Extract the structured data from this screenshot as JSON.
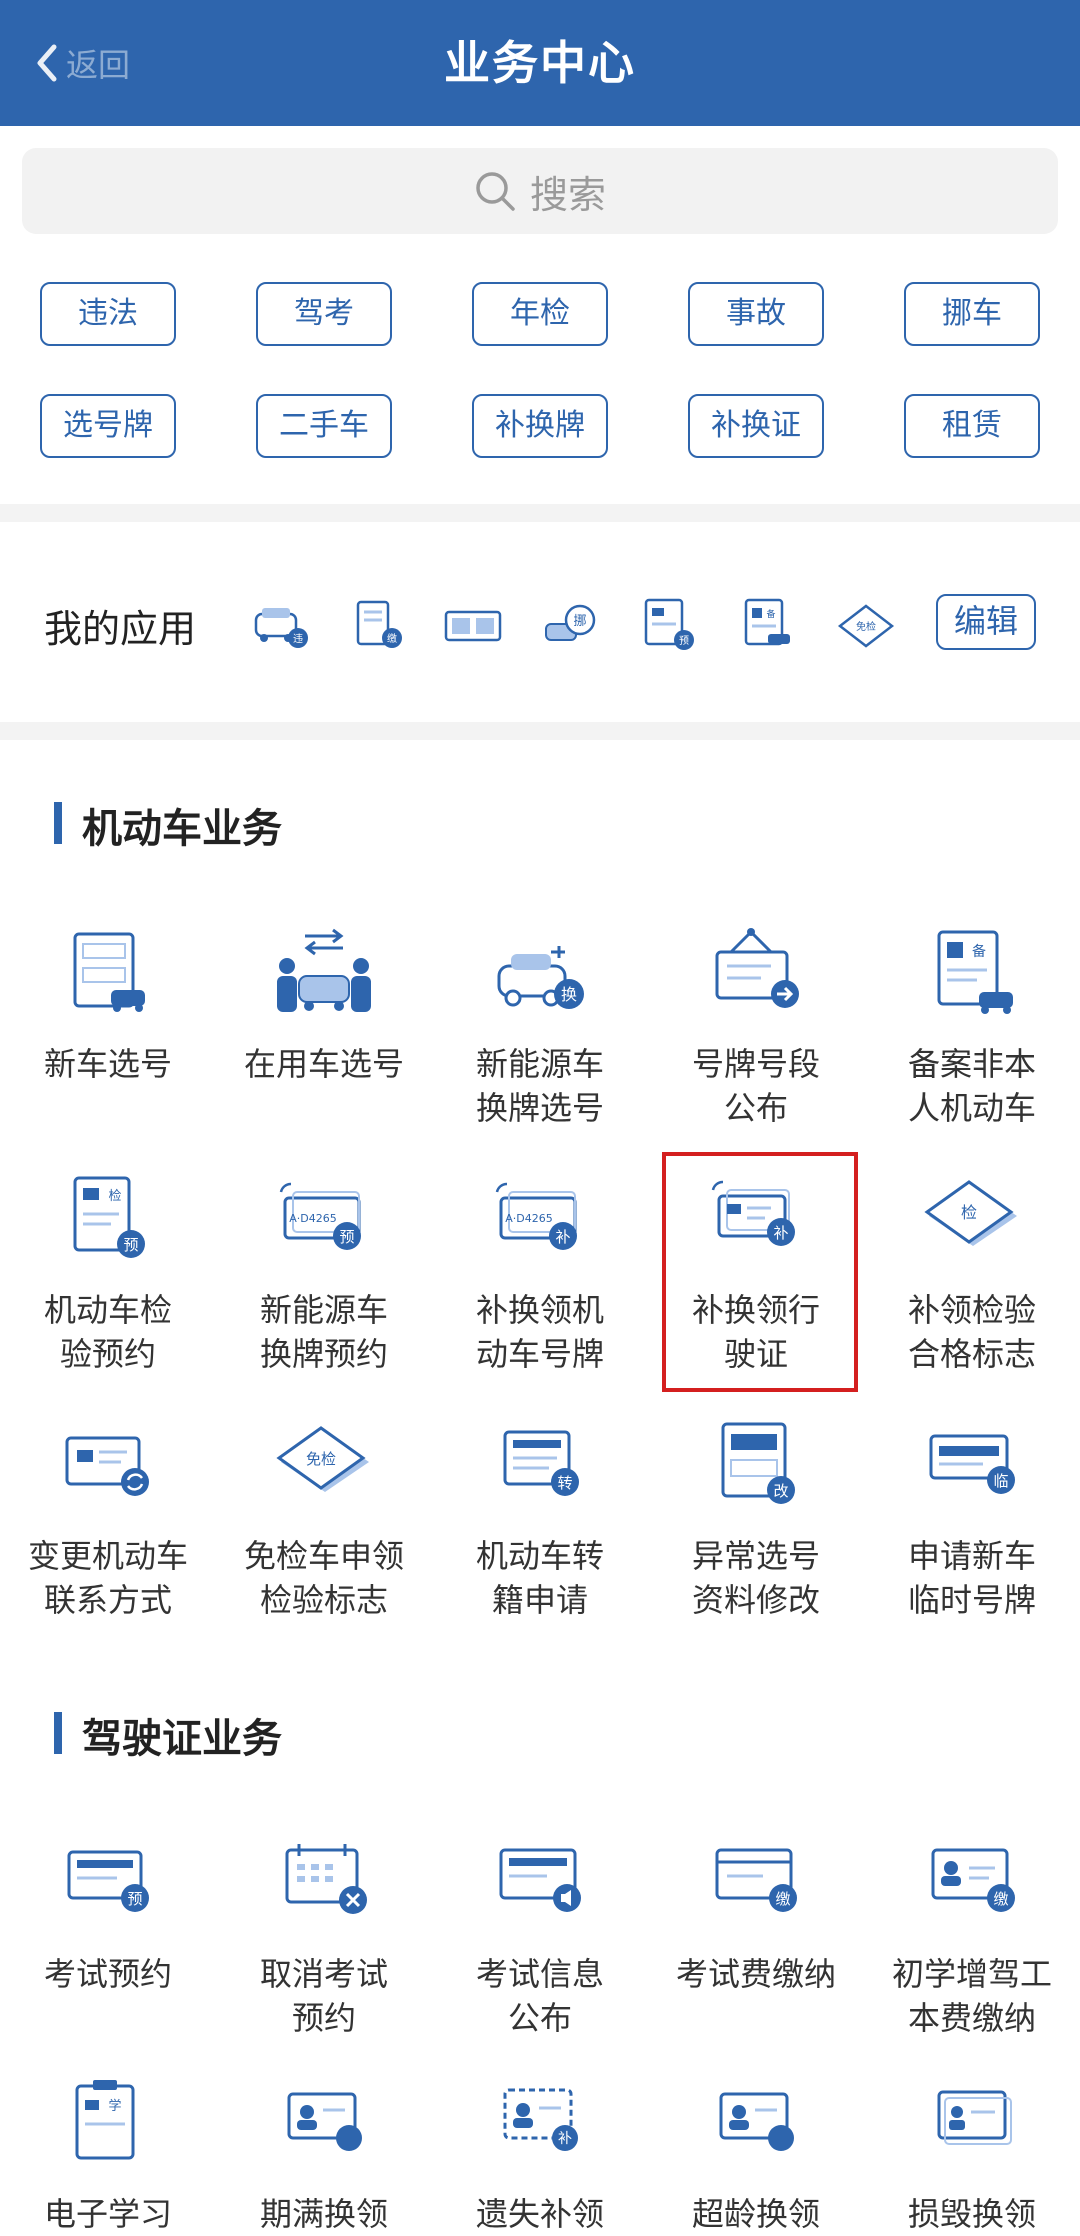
{
  "header": {
    "title": "业务中心",
    "back_label": "返回"
  },
  "search": {
    "placeholder": "搜索"
  },
  "quick_tags": [
    "违法",
    "驾考",
    "年检",
    "事故",
    "挪车",
    "选号牌",
    "二手车",
    "补换牌",
    "补换证",
    "租赁"
  ],
  "my_apps": {
    "label": "我的应用",
    "edit_label": "编辑",
    "icons": [
      "car-violation-icon",
      "document-pay-icon",
      "plates-icon",
      "move-car-icon",
      "inspection-booking-icon",
      "record-icon",
      "inspection-exempt-icon"
    ],
    "badges": [
      "违",
      "缴",
      "",
      "挪",
      "预",
      "备",
      "免检"
    ]
  },
  "motor_section": {
    "title": "机动车业务",
    "items": [
      {
        "label": "新车选号",
        "icon": "new-car-plate-icon",
        "badge": ""
      },
      {
        "label": "在用车选号",
        "icon": "swap-owner-icon",
        "badge": ""
      },
      {
        "label": "新能源车\n换牌选号",
        "icon": "ev-car-icon",
        "badge": "换"
      },
      {
        "label": "号牌号段\n公布",
        "icon": "notice-board-icon",
        "badge": ""
      },
      {
        "label": "备案非本\n人机动车",
        "icon": "record-car-icon",
        "badge": "备"
      },
      {
        "label": "机动车检\n验预约",
        "icon": "inspection-doc-icon",
        "badge": "预"
      },
      {
        "label": "新能源车\n换牌预约",
        "icon": "ev-plate-booking-icon",
        "badge": "预"
      },
      {
        "label": "补换领机\n动车号牌",
        "icon": "plate-replace-icon",
        "badge": "补"
      },
      {
        "label": "补换领行\n驶证",
        "icon": "license-replace-icon",
        "badge": "补"
      },
      {
        "label": "补领检验\n合格标志",
        "icon": "inspection-mark-icon",
        "badge": "检"
      },
      {
        "label": "变更机动车\n联系方式",
        "icon": "change-contact-icon",
        "badge": ""
      },
      {
        "label": "免检车申领\n检验标志",
        "icon": "exempt-mark-icon",
        "badge": "免检"
      },
      {
        "label": "机动车转\n籍申请",
        "icon": "transfer-icon",
        "badge": "转"
      },
      {
        "label": "异常选号\n资料修改",
        "icon": "modify-plate-icon",
        "badge": "改"
      },
      {
        "label": "申请新车\n临时号牌",
        "icon": "temp-plate-icon",
        "badge": "临"
      }
    ]
  },
  "license_section": {
    "title": "驾驶证业务",
    "items": [
      {
        "label": "考试预约",
        "icon": "exam-booking-icon",
        "badge": "预"
      },
      {
        "label": "取消考试\n预约",
        "icon": "cancel-exam-icon",
        "badge": ""
      },
      {
        "label": "考试信息\n公布",
        "icon": "exam-info-icon",
        "badge": ""
      },
      {
        "label": "考试费缴纳",
        "icon": "exam-fee-icon",
        "badge": "缴"
      },
      {
        "label": "初学增驾工\n本费缴纳",
        "icon": "cost-pay-icon",
        "badge": "缴"
      },
      {
        "label": "电子学习",
        "icon": "e-learning-icon",
        "badge": "学"
      },
      {
        "label": "期满换领",
        "icon": "expire-renew-icon",
        "badge": ""
      },
      {
        "label": "遗失补领",
        "icon": "lost-reissue-icon",
        "badge": "补"
      },
      {
        "label": "超龄换领",
        "icon": "overage-renew-icon",
        "badge": ""
      },
      {
        "label": "损毁换领",
        "icon": "damage-renew-icon",
        "badge": ""
      }
    ]
  },
  "colors": {
    "primary": "#2e65ad",
    "icon_light": "#a9c4ea",
    "highlight": "#d41f1f"
  }
}
